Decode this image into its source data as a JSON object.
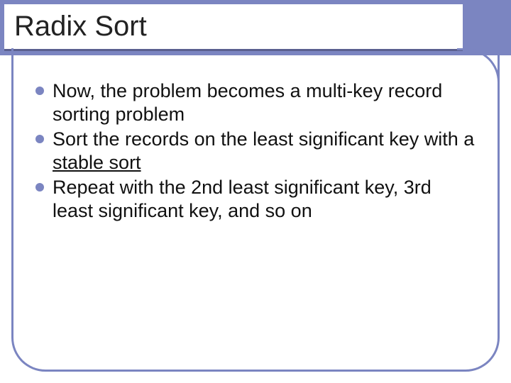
{
  "slide": {
    "title": "Radix Sort",
    "bullets": [
      {
        "pre": "Now, the problem becomes a multi-key record sorting problem",
        "ul": "",
        "post": ""
      },
      {
        "pre": "Sort the records on the least significant key with a ",
        "ul": "stable sort",
        "post": ""
      },
      {
        "pre": "Repeat with the 2nd least significant key, 3rd least significant key, and so on",
        "ul": "",
        "post": ""
      }
    ]
  },
  "theme": {
    "accent": "#7b85c1",
    "rule": "#5a5f8f"
  }
}
